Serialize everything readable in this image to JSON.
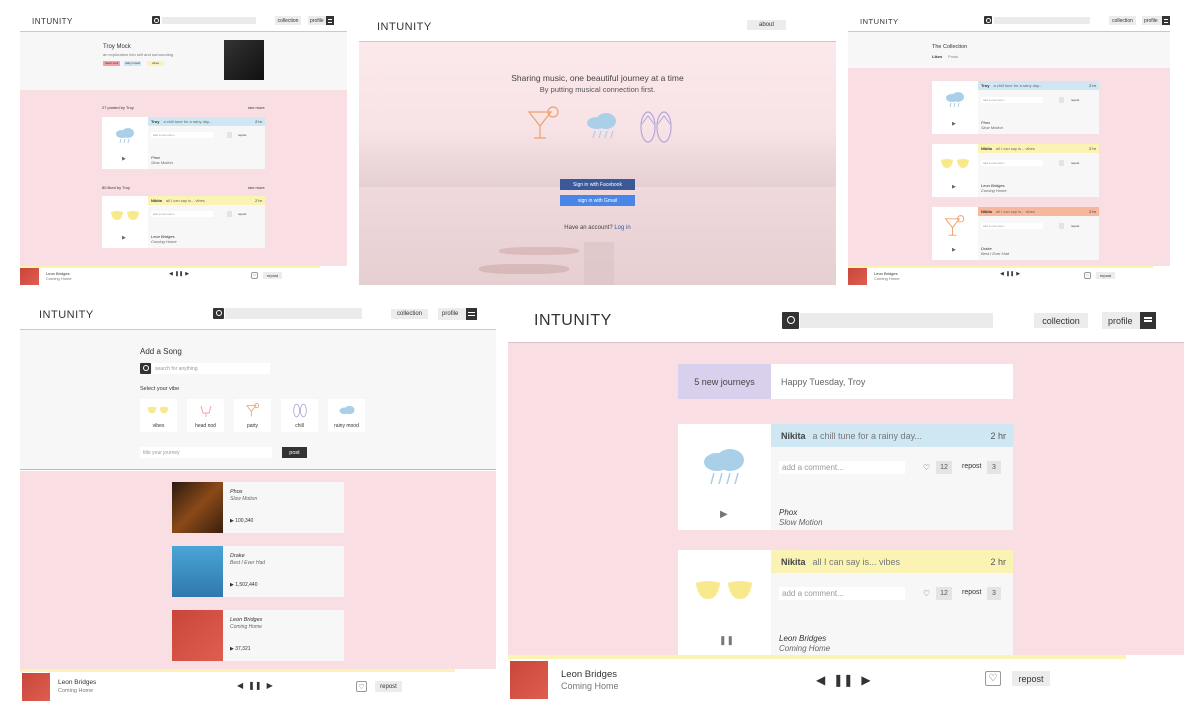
{
  "brand": "INTUNITY",
  "nav": {
    "collection": "collection",
    "profile": "profile",
    "about": "about"
  },
  "player": {
    "artist": "Leon Bridges",
    "song": "Coming Home",
    "repost": "repost"
  },
  "profile": {
    "name": "Troy Mock",
    "tagline": "an exploration into self and surrounding",
    "tags": [
      "heart soul",
      "rainy mood",
      "vibes"
    ],
    "posted_title": "27 posted by Troy",
    "liked_title": "80 liked by Troy",
    "see_more": "see more",
    "post1": {
      "user": "Troy",
      "text": "a chill tune for a rainy day...",
      "time": "2 hr",
      "comment": "add a comment...",
      "artist": "Phox",
      "song": "Slow Motion"
    },
    "post2": {
      "user": "Nikita",
      "text": "all I can say is... vibes",
      "time": "2 hr",
      "comment": "add a comment...",
      "artist": "Leon Bridges",
      "song": "Coming Home"
    }
  },
  "landing": {
    "headline": "Sharing music, one beautiful journey at a time",
    "sub": "By putting musical connection first.",
    "facebook": "Sign in with Facebook",
    "gmail": "sign in with Gmail",
    "account": "Have an account?",
    "login": "Log in"
  },
  "collection": {
    "title": "The Collection",
    "tab_likes": "Likes",
    "tab_posts": "Posts",
    "cards": [
      {
        "user": "Troy",
        "text": "a chill tune for a rainy day...",
        "time": "2 hr",
        "artist": "Phox",
        "song": "Slow Motion"
      },
      {
        "user": "Nikita",
        "text": "all I can say is... vibes",
        "time": "2 hr",
        "artist": "Leon Bridges",
        "song": "Coming Home"
      },
      {
        "user": "Nikita",
        "text": "all I can say is... vibes",
        "time": "2 hr",
        "artist": "Drake",
        "song": "Best I Ever Had"
      }
    ],
    "comment": "add a comment..."
  },
  "add": {
    "title": "Add a Song",
    "search": "search for anything",
    "vibe_title": "Select your vibe",
    "vibes": [
      "vibes",
      "head nod",
      "party",
      "chill",
      "rainy mood"
    ],
    "journey": "title your journey",
    "post": "post",
    "results": [
      {
        "artist": "Phox",
        "song": "Slow Motion",
        "plays": "100,340"
      },
      {
        "artist": "Drake",
        "song": "Best I Ever Had",
        "plays": "1,502,440"
      },
      {
        "artist": "Leon Bridges",
        "song": "Coming Home",
        "plays": "37,321"
      }
    ]
  },
  "feed": {
    "new": "5 new journeys",
    "greeting": "Happy Tuesday, Troy",
    "comment": "add a comment...",
    "likes": "12",
    "reposts": "3",
    "repost": "repost",
    "posts": [
      {
        "user": "Nikita",
        "text": "a chill tune for a rainy day...",
        "time": "2 hr",
        "artist": "Phox",
        "song": "Slow Motion"
      },
      {
        "user": "Nikita",
        "text": "all I can say is... vibes",
        "time": "2 hr",
        "artist": "Leon Bridges",
        "song": "Coming Home"
      }
    ]
  },
  "colors": {
    "pink": "#f9dfe3",
    "blue": "#cfe7f3",
    "yellow": "#fbf3b4",
    "orange": "#f7b79a",
    "purple": "#d9d0ee",
    "fb": "#3b5998",
    "gmail": "#4a86e8"
  }
}
